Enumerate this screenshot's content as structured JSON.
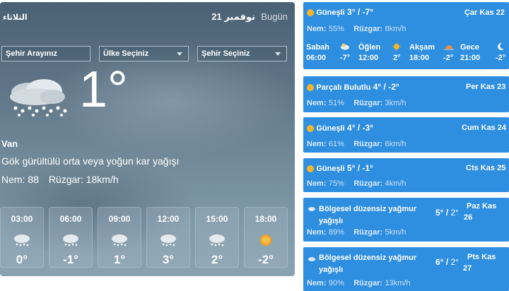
{
  "left": {
    "day": "الثلاثاء",
    "date": "21 نوفمبر",
    "today": "Bugün",
    "selects": [
      "Şehir Arayınız",
      "Ülke Seçiniz",
      "Şehir Seçiniz"
    ],
    "current_temp": "1°",
    "city": "Van",
    "condition": "Gök gürültülü orta veya yoğun kar yağışı",
    "humidity": "Nem: 88",
    "wind": "Rüzgar: 18km/h",
    "hours": [
      {
        "time": "03:00",
        "temp": "0°",
        "icon": "snow-icon"
      },
      {
        "time": "06:00",
        "temp": "-1°",
        "icon": "snow-icon"
      },
      {
        "time": "09:00",
        "temp": "1°",
        "icon": "snow-icon"
      },
      {
        "time": "12:00",
        "temp": "3°",
        "icon": "snow-icon"
      },
      {
        "time": "15:00",
        "temp": "2°",
        "icon": "snow-icon"
      },
      {
        "time": "18:00",
        "temp": "-2°",
        "icon": "sun-icon"
      }
    ]
  },
  "forecast": [
    {
      "condition": "Güneşli",
      "high": "3°",
      "low": "-7°",
      "date": "Çar Kas 22",
      "humidity_label": "Nem:",
      "humidity": "55%",
      "wind_label": "Rüzgar:",
      "wind": "8km/h",
      "parts": [
        {
          "name": "Sabah",
          "time": "06:00",
          "temp": "-7°"
        },
        {
          "name": "Öğlen",
          "time": "12:00",
          "temp": "2°"
        },
        {
          "name": "Akşam",
          "time": "18:00",
          "temp": "-2°"
        },
        {
          "name": "Gece",
          "time": "21:00",
          "temp": "-2°"
        }
      ]
    },
    {
      "condition": "Parçalı Bulutlu",
      "high": "4°",
      "low": "-2°",
      "date": "Per Kas 23",
      "humidity_label": "Nem:",
      "humidity": "51%",
      "wind_label": "Rüzgar:",
      "wind": "3km/h"
    },
    {
      "condition": "Güneşli",
      "high": "4°",
      "low": "-3°",
      "date": "Cum Kas 24",
      "humidity_label": "Nem:",
      "humidity": "61%",
      "wind_label": "Rüzgar:",
      "wind": "6km/h"
    },
    {
      "condition": "Güneşli",
      "high": "5°",
      "low": "-1°",
      "date": "Cts Kas 25",
      "humidity_label": "Nem:",
      "humidity": "75%",
      "wind_label": "Rüzgar:",
      "wind": "4km/h"
    },
    {
      "condition": "Bölgesel düzensiz yağmur yağışlı",
      "high": "5°",
      "low": "2°",
      "date_day": "Paz Kas",
      "date_num": "26",
      "humidity_label": "Nem:",
      "humidity": "89%",
      "wind_label": "Rüzgar:",
      "wind": "5km/h"
    },
    {
      "condition": "Bölgesel düzensiz yağmur yağışlı",
      "high": "6°",
      "low": "2°",
      "date_day": "Pts Kas",
      "date_num": "27",
      "humidity_label": "Nem:",
      "humidity": "90%",
      "wind_label": "Rüzgar:",
      "wind": "13km/h"
    }
  ],
  "colors": {
    "card": "#2e8ee0",
    "sun": "#f4b629"
  }
}
